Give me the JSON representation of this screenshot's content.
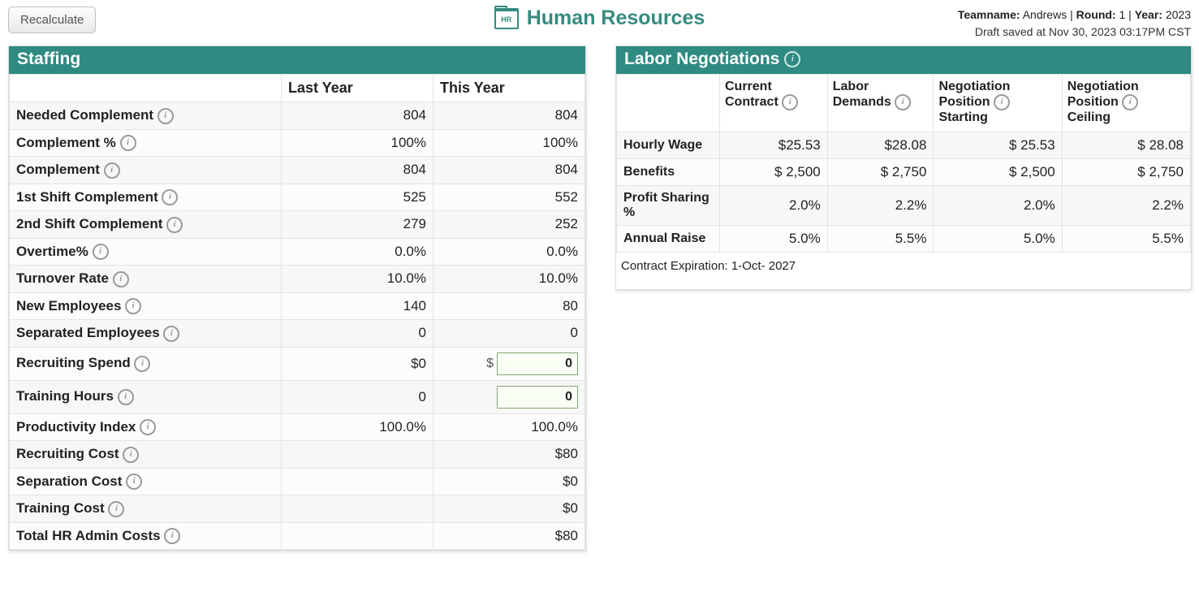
{
  "buttons": {
    "recalculate": "Recalculate"
  },
  "page": {
    "title": "Human Resources",
    "hr_badge": "HR"
  },
  "meta": {
    "team_label": "Teamname:",
    "team_value": "Andrews",
    "round_label": "Round:",
    "round_value": "1",
    "year_label": "Year:",
    "year_value": "2023",
    "saved": "Draft saved at Nov 30, 2023 03:17PM CST",
    "sep": " | "
  },
  "staffing": {
    "header": "Staffing",
    "col_last": "Last Year",
    "col_this": "This Year",
    "rows": {
      "needed_complement": {
        "label": "Needed Complement",
        "last": "804",
        "this": "804"
      },
      "complement_pct": {
        "label": "Complement %",
        "last": "100%",
        "this": "100%"
      },
      "complement": {
        "label": "Complement",
        "last": "804",
        "this": "804"
      },
      "shift1": {
        "label": "1st Shift Complement",
        "last": "525",
        "this": "552"
      },
      "shift2": {
        "label": "2nd Shift Complement",
        "last": "279",
        "this": "252"
      },
      "overtime_pct": {
        "label": "Overtime%",
        "last": "0.0%",
        "this": "0.0%"
      },
      "turnover": {
        "label": "Turnover Rate",
        "last": "10.0%",
        "this": "10.0%"
      },
      "new_emp": {
        "label": "New Employees",
        "last": "140",
        "this": "80"
      },
      "sep_emp": {
        "label": "Separated Employees",
        "last": "0",
        "this": "0"
      },
      "recruiting_spend": {
        "label": "Recruiting Spend",
        "last": "$0",
        "this_input": "0",
        "prefix": "$"
      },
      "training_hours": {
        "label": "Training Hours",
        "last": "0",
        "this_input": "0"
      },
      "productivity": {
        "label": "Productivity Index",
        "last": "100.0%",
        "this": "100.0%"
      },
      "recruiting_cost": {
        "label": "Recruiting Cost",
        "last": "",
        "this": "$80"
      },
      "separation_cost": {
        "label": "Separation Cost",
        "last": "",
        "this": "$0"
      },
      "training_cost": {
        "label": "Training Cost",
        "last": "",
        "this": "$0"
      },
      "total_hr": {
        "label": "Total HR Admin Costs",
        "last": "",
        "this": "$80"
      }
    }
  },
  "labor": {
    "header": "Labor Negotiations",
    "cols": {
      "current": "Current Contract",
      "demands": "Labor Demands",
      "neg_start": "Negotiation Position Starting",
      "neg_ceil": "Negotiation Position Ceiling"
    },
    "rows": {
      "wage": {
        "label": "Hourly Wage",
        "current": "$25.53",
        "demands": "$28.08",
        "start": "$ 25.53",
        "ceil": "$ 28.08"
      },
      "benefits": {
        "label": "Benefits",
        "current": "$ 2,500",
        "demands": "$ 2,750",
        "start": "$ 2,500",
        "ceil": "$ 2,750"
      },
      "profit": {
        "label": "Profit Sharing %",
        "current": "2.0%",
        "demands": "2.2%",
        "start": "2.0%",
        "ceil": "2.2%"
      },
      "raise": {
        "label": "Annual Raise",
        "current": "5.0%",
        "demands": "5.5%",
        "start": "5.0%",
        "ceil": "5.5%"
      }
    },
    "contract_exp_label": "Contract Expiration:",
    "contract_exp_value": "1-Oct- 2027"
  }
}
